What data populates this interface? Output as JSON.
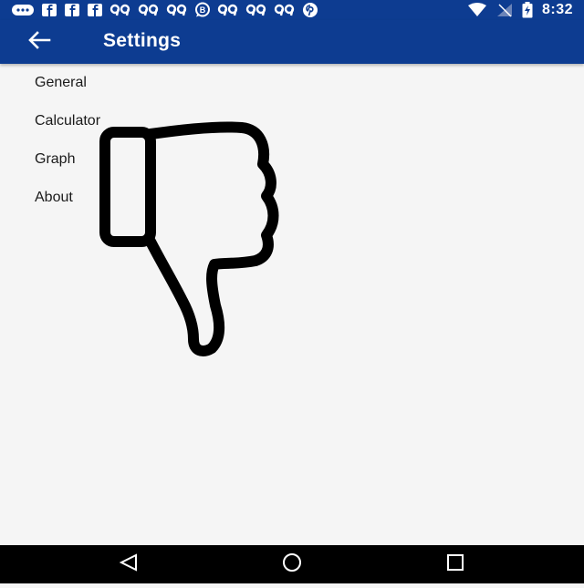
{
  "status_bar": {
    "left_icons": [
      "message-icon",
      "facebook-icon",
      "facebook-icon",
      "facebook-icon",
      "notification-icon",
      "notification-icon",
      "notification-icon",
      "whatsapp-icon",
      "notification-icon",
      "notification-icon",
      "notification-icon",
      "pinterest-icon"
    ],
    "right_icons": [
      "wifi-icon",
      "signal-icon",
      "battery-charging-icon"
    ],
    "time": "8:32"
  },
  "app_bar": {
    "back_icon": "arrow-left-icon",
    "title": "Settings",
    "color": "#0d3c91"
  },
  "settings": {
    "items": [
      {
        "label": "General"
      },
      {
        "label": "Calculator"
      },
      {
        "label": "Graph"
      },
      {
        "label": "About"
      }
    ]
  },
  "overlay": {
    "icon": "thumbs-down-icon"
  },
  "nav_bar": {
    "buttons": [
      "back-triangle-icon",
      "home-circle-icon",
      "recents-square-icon"
    ]
  }
}
